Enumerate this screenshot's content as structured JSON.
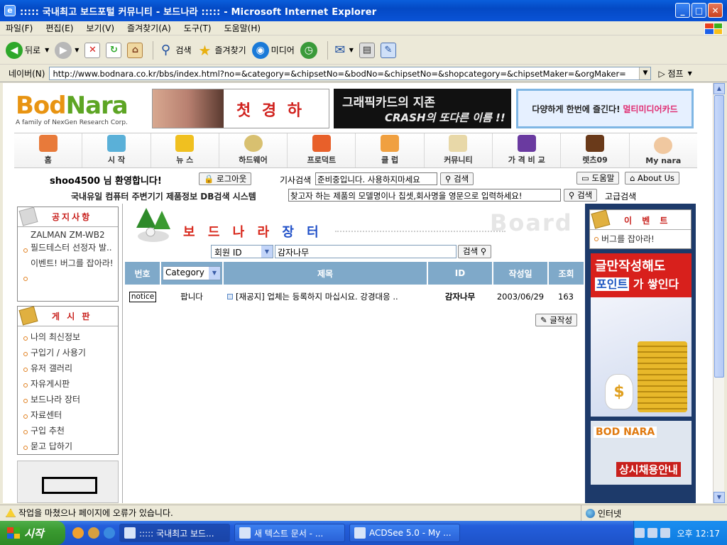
{
  "window": {
    "title": "::::: 국내최고 보드포털 커뮤니티 - 보드나라 ::::: - Microsoft Internet Explorer"
  },
  "menu": [
    "파일(F)",
    "편집(E)",
    "보기(V)",
    "즐겨찾기(A)",
    "도구(T)",
    "도움말(H)"
  ],
  "toolbar": {
    "back": "뒤로",
    "search": "검색",
    "favorites": "즐겨찾기",
    "media": "미디어"
  },
  "address": {
    "label": "네이버(N)",
    "url": "http://www.bodnara.co.kr/bbs/index.html?no=&category=&chipsetNo=&bodNo=&chipsetNo=&shopcategory=&chipsetMaker=&orgMaker=",
    "go": "점프"
  },
  "site": {
    "logo_bod": "Bod",
    "logo_nara": "Nara",
    "tagline": "A family of NexGen Research Corp.",
    "banner1": "첫 경 하",
    "banner2_l1": "그래픽카드의 지존",
    "banner2_l2": "CRASH의 또다른 이름 !!",
    "banner3_a": "다양하게 한번에 즐긴다!",
    "banner3_b": "멀티미디어카드",
    "nav": [
      "홈",
      "시 작",
      "뉴 스",
      "하드웨어",
      "프로덕트",
      "클 럽",
      "커뮤니티",
      "가 격 비 교",
      "렛츠09",
      "My nara"
    ],
    "welcome": "shoo4500 님 환영합니다!",
    "logout": "로그아웃",
    "article_search_label": "기사검색",
    "article_search_value": "준비중입니다. 사용하지마세요",
    "search_btn": "검색",
    "help_btn": "도움말",
    "about_btn": "About Us",
    "db_label": "국내유일 컴퓨터 주변기기 제품정보 DB검색 시스템",
    "db_placeholder": "찾고자 하는 제품의 모델명이나 칩셋,회사명을 영문으로 입력하세요!",
    "db_btn": "검색",
    "db_adv": "고급검색"
  },
  "sidebar": {
    "notice_title": "공지사항",
    "notice_items": [
      "ZALMAN ZM-WB2 필드테스터 선정자 발..",
      "이벤트! 버그를 잡아라!"
    ],
    "board_title": "게 시 판",
    "board_items": [
      "나의 최신정보",
      "구입기 / 사용기",
      "유저 갤러리",
      "자유게시판",
      "보드나라 장터",
      "자료센터",
      "구입 추천",
      "묻고 답하기"
    ]
  },
  "board": {
    "title_red": "보 드 나 라",
    "title_blue": "장 터",
    "bg_word": "Board",
    "search_field": "회원 ID",
    "search_keyword": "감자나무",
    "search_btn": "검색",
    "columns": [
      "번호",
      "Category",
      "제목",
      "ID",
      "작성일",
      "조회"
    ],
    "rows": [
      {
        "no": "notice",
        "category": "팝니다",
        "subject": "[재공지] 업체는 등록하지 마십시요. 강경대응 ..",
        "id": "감자나무",
        "date": "2003/06/29",
        "views": "163"
      }
    ],
    "write_btn": "글작성"
  },
  "right": {
    "event_title": "이 벤 트",
    "event_items": [
      "버그를 잡아라!"
    ],
    "ad1_a": "글만작성해도",
    "ad1_b_pt": "포인트",
    "ad1_b_rest": "가 쌓인다",
    "ad2_l1": "BOD NARA",
    "ad2_l2": "상시채용안내"
  },
  "status": {
    "text": "작업을 마쳤으나 페이지에 오류가 있습니다.",
    "zone": "인터넷"
  },
  "taskbar": {
    "start": "시작",
    "tasks": [
      "::::: 국내최고 보드...",
      "새 텍스트 문서 - ...",
      "ACDSee 5.0 - My ..."
    ],
    "clock": "오후 12:17"
  }
}
